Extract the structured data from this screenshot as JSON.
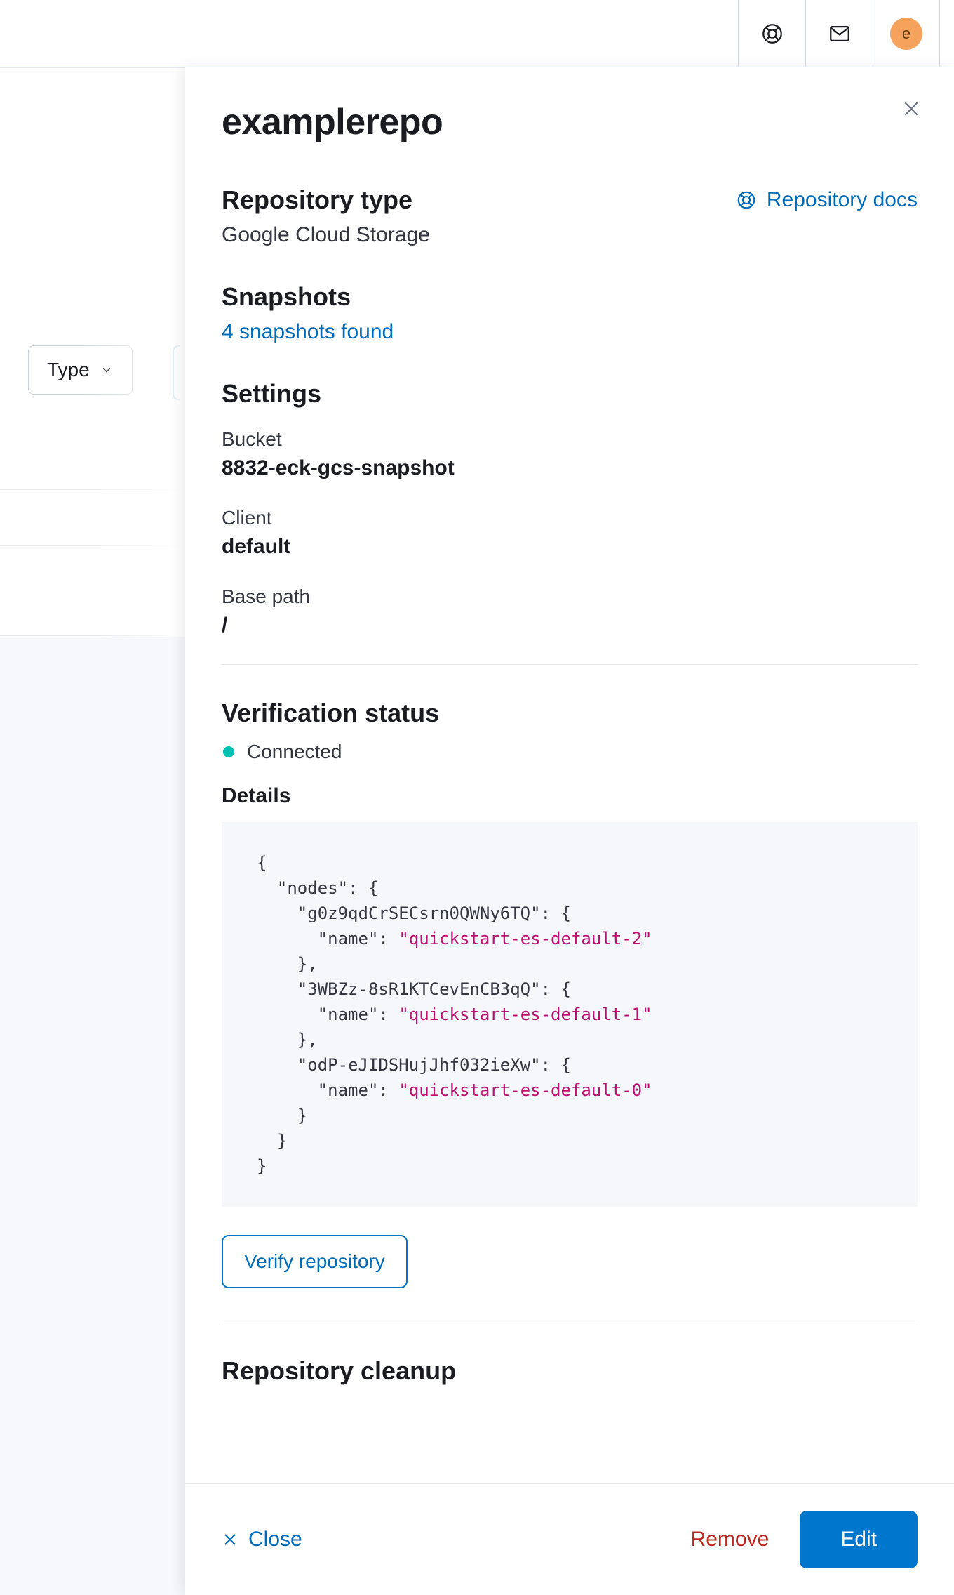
{
  "topbar": {
    "avatar_initial": "e"
  },
  "bg": {
    "type_filter_label": "Type"
  },
  "flyout": {
    "title": "examplerepo",
    "docs_link": "Repository docs",
    "repo_type_heading": "Repository type",
    "repo_type_value": "Google Cloud Storage",
    "snapshots_heading": "Snapshots",
    "snapshots_link": "4 snapshots found",
    "settings_heading": "Settings",
    "settings": {
      "bucket_label": "Bucket",
      "bucket_value": "8832-eck-gcs-snapshot",
      "client_label": "Client",
      "client_value": "default",
      "basepath_label": "Base path",
      "basepath_value": "/"
    },
    "verification_heading": "Verification status",
    "status_text": "Connected",
    "details_heading": "Details",
    "details_json": {
      "nodes": [
        {
          "id": "g0z9qdCrSECsrn0QWNy6TQ",
          "name": "quickstart-es-default-2"
        },
        {
          "id": "3WBZz-8sR1KTCevEnCB3qQ",
          "name": "quickstart-es-default-1"
        },
        {
          "id": "odP-eJIDSHujJhf032ieXw",
          "name": "quickstart-es-default-0"
        }
      ]
    },
    "verify_button": "Verify repository",
    "cleanup_heading": "Repository cleanup"
  },
  "footer": {
    "close": "Close",
    "remove": "Remove",
    "edit": "Edit"
  }
}
